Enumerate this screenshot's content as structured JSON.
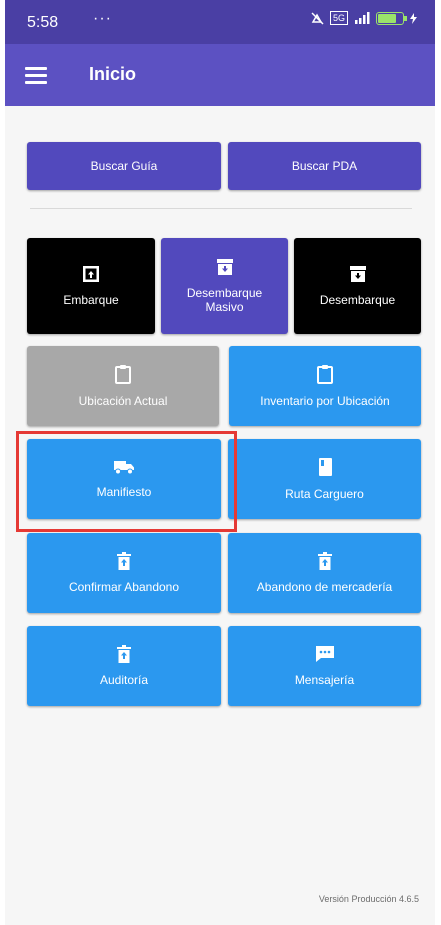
{
  "status_bar": {
    "time": "5:58",
    "dots": "···",
    "network": "5G",
    "colors": {
      "bar": "#4a3fa4",
      "battery": "#9be36a"
    }
  },
  "app_bar": {
    "title": "Inicio",
    "menu_icon": "hamburger-menu-icon",
    "color": "#5c51c2"
  },
  "search_buttons": [
    {
      "label": "Buscar Guía"
    },
    {
      "label": "Buscar PDA"
    }
  ],
  "tiles": [
    {
      "label": "Embarque",
      "icon": "upload-box-icon",
      "color": "#000000"
    },
    {
      "label": "Desembarque\nMasivo",
      "icon": "archive-down-icon",
      "color": "#5249bd"
    },
    {
      "label": "Desembarque",
      "icon": "archive-down-icon",
      "color": "#000000"
    },
    {
      "label": "Ubicación Actual",
      "icon": "clipboard-icon",
      "color": "#a8a8a8"
    },
    {
      "label": "Inventario por Ubicación",
      "icon": "clipboard-icon",
      "color": "#2b98ef"
    },
    {
      "label": "Manifiesto",
      "icon": "truck-icon",
      "color": "#2b98ef"
    },
    {
      "label": "Ruta Carguero",
      "icon": "book-icon",
      "color": "#2b98ef"
    },
    {
      "label": "Confirmar Abandono",
      "icon": "trash-icon",
      "color": "#2b98ef"
    },
    {
      "label": "Abandono de mercadería",
      "icon": "trash-icon",
      "color": "#2b98ef"
    },
    {
      "label": "Auditoría",
      "icon": "trash-icon",
      "color": "#2b98ef"
    },
    {
      "label": "Mensajería",
      "icon": "message-icon",
      "color": "#2b98ef"
    }
  ],
  "highlight_color": "#e53935",
  "footer": {
    "version": "Versión Producción 4.6.5"
  }
}
